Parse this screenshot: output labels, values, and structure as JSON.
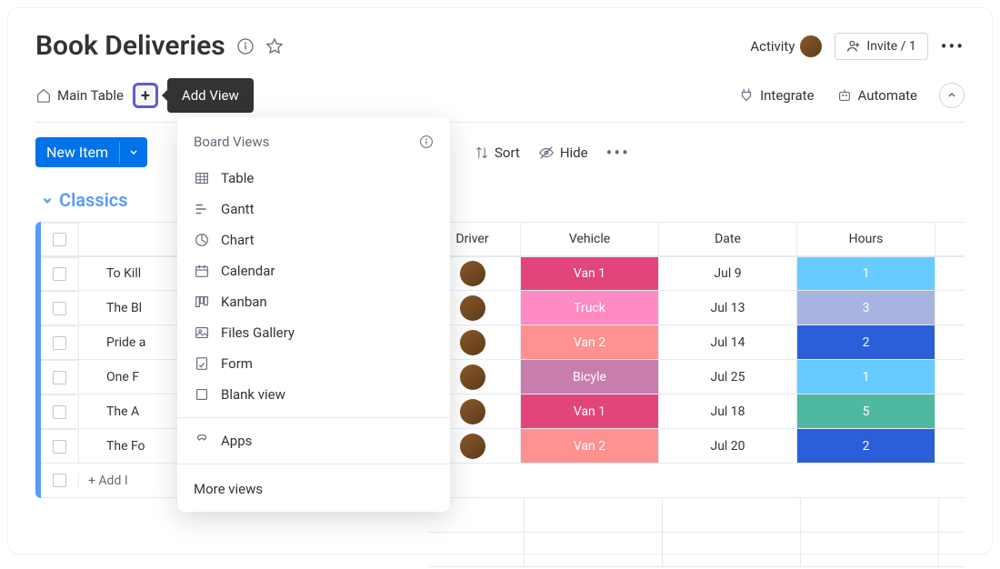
{
  "header": {
    "title": "Book Deliveries",
    "activity": "Activity",
    "invite": "Invite / 1"
  },
  "tabs": {
    "main": "Main Table",
    "add_tooltip": "Add View",
    "integrate": "Integrate",
    "automate": "Automate"
  },
  "toolbar": {
    "new_item": "New Item",
    "sort": "Sort",
    "hide": "Hide"
  },
  "group": {
    "title": "Classics"
  },
  "columns": {
    "name": "",
    "driver": "Driver",
    "vehicle": "Vehicle",
    "date": "Date",
    "hours": "Hours"
  },
  "rows": [
    {
      "name": "To Kill",
      "vehicle": "Van 1",
      "vehicle_bg": "#e2457b",
      "date": "Jul 9",
      "hours": "1",
      "hours_bg": "#66ccff"
    },
    {
      "name": "The Bl",
      "vehicle": "Truck",
      "vehicle_bg": "#ff8ac4",
      "date": "Jul 13",
      "hours": "3",
      "hours_bg": "#a8b4e0"
    },
    {
      "name": "Pride a",
      "vehicle": "Van 2",
      "vehicle_bg": "#ff9191",
      "date": "Jul 14",
      "hours": "2",
      "hours_bg": "#2a5fd9"
    },
    {
      "name": "One F",
      "vehicle": "Bicyle",
      "vehicle_bg": "#c77dad",
      "date": "Jul 25",
      "hours": "1",
      "hours_bg": "#66ccff"
    },
    {
      "name": "The A",
      "vehicle": "Van 1",
      "vehicle_bg": "#e2457b",
      "date": "Jul 18",
      "hours": "5",
      "hours_bg": "#4eb8a0"
    },
    {
      "name": "The Fo",
      "vehicle": "Van 2",
      "vehicle_bg": "#ff9191",
      "date": "Jul 20",
      "hours": "2",
      "hours_bg": "#2a5fd9"
    }
  ],
  "add_row": "+ Add I",
  "dropdown": {
    "header": "Board Views",
    "items": [
      {
        "label": "Table",
        "icon": "table"
      },
      {
        "label": "Gantt",
        "icon": "gantt"
      },
      {
        "label": "Chart",
        "icon": "chart"
      },
      {
        "label": "Calendar",
        "icon": "calendar"
      },
      {
        "label": "Kanban",
        "icon": "kanban"
      },
      {
        "label": "Files Gallery",
        "icon": "gallery"
      },
      {
        "label": "Form",
        "icon": "form"
      },
      {
        "label": "Blank view",
        "icon": "blank"
      }
    ],
    "apps": "Apps",
    "more": "More views"
  }
}
